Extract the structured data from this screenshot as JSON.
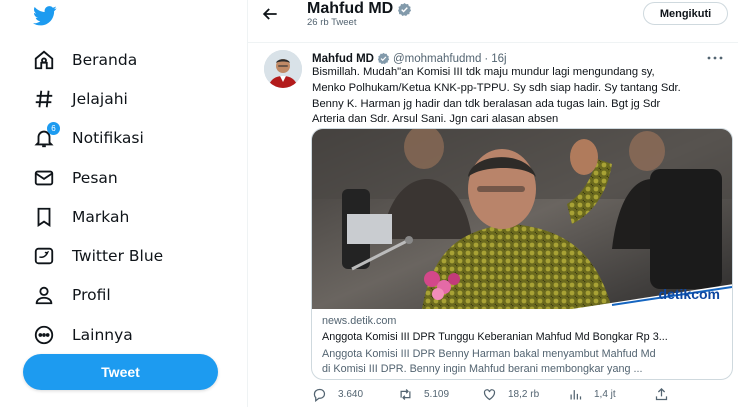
{
  "sidebar": {
    "logo": "twitter-bird-icon",
    "items": [
      {
        "label": "Beranda",
        "icon": "home-icon"
      },
      {
        "label": "Jelajahi",
        "icon": "hashtag-icon"
      },
      {
        "label": "Notifikasi",
        "icon": "bell-icon",
        "badge": "6"
      },
      {
        "label": "Pesan",
        "icon": "envelope-icon"
      },
      {
        "label": "Markah",
        "icon": "bookmark-icon"
      },
      {
        "label": "Twitter Blue",
        "icon": "twitter-blue-icon"
      },
      {
        "label": "Profil",
        "icon": "person-icon"
      },
      {
        "label": "Lainnya",
        "icon": "more-circle-icon"
      }
    ],
    "tweet_button": "Tweet"
  },
  "header": {
    "name": "Mahfud MD",
    "tweet_count": "26 rb Tweet",
    "follow_button": "Mengikuti"
  },
  "tweet": {
    "name": "Mahfud MD",
    "handle": "@mohmahfudmd",
    "separator": "·",
    "time": "16j",
    "text_lines": [
      "Bismillah. Mudah\"an Komisi III tdk maju mundur lagi mengundang sy,",
      "Menko Polhukam/Ketua KNK-pp-TPPU. Sy sdh siap hadir. Sy tantang Sdr.",
      "Benny K. Harman jg hadir dan tdk beralasan ada tugas lain. Bgt jg Sdr",
      "Arteria dan Sdr. Arsul Sani. Jgn cari alasan absen"
    ]
  },
  "card": {
    "watermark": "detikcom",
    "domain": "news.detik.com",
    "title": "Anggota Komisi III DPR Tunggu Keberanian Mahfud Md Bongkar Rp 3...",
    "desc_lines": [
      "Anggota Komisi III DPR Benny Harman bakal menyambut Mahfud Md",
      "di Komisi III DPR. Benny ingin Mahfud berani membongkar yang ..."
    ]
  },
  "actions": {
    "replies": "3.640",
    "retweets": "5.109",
    "likes": "18,2 rb",
    "views": "1,4 jt"
  },
  "colors": {
    "accent": "#1d9bf0",
    "text": "#0f1419",
    "secondary": "#536471",
    "border": "#cfd9de"
  }
}
